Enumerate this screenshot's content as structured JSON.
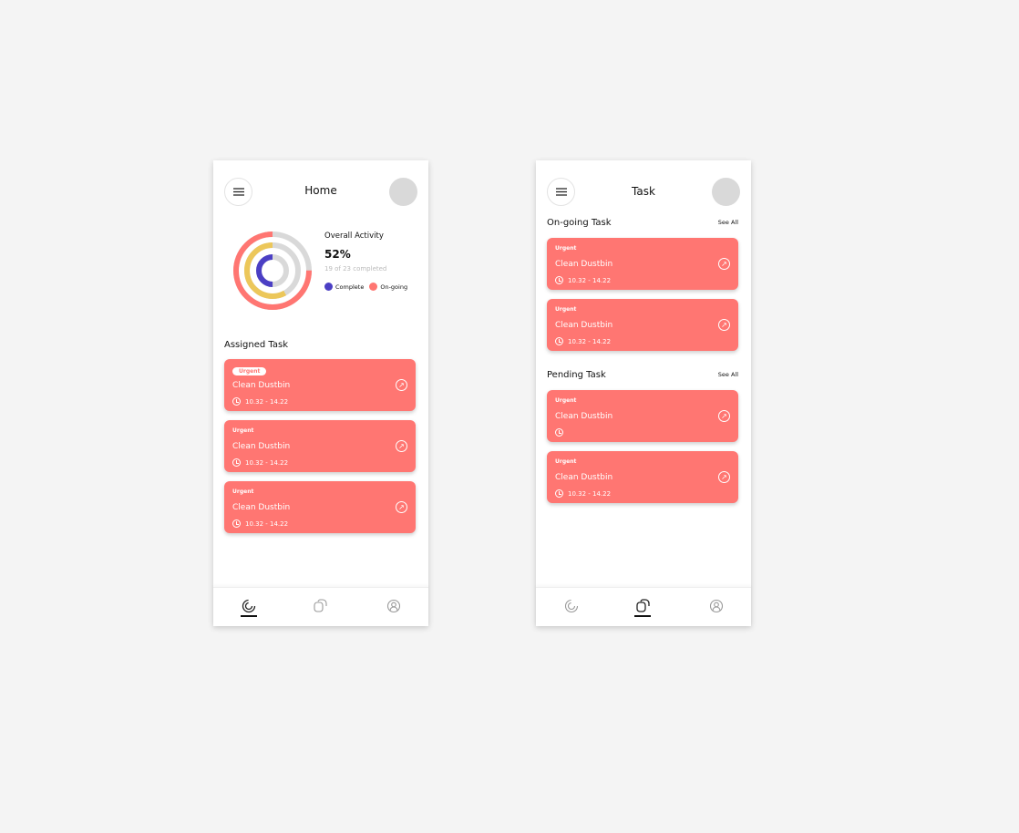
{
  "colors": {
    "card": "#ff7672",
    "complete": "#4b3fc4",
    "ongoing": "#ff7672",
    "yellow": "#ecc75a",
    "track": "#d9d9d9"
  },
  "home": {
    "title": "Home",
    "activity": {
      "title": "Overall Activity",
      "percent": "52%",
      "summary": "19 of 23 completed",
      "legend": [
        "Complete",
        "On-going"
      ],
      "rings": {
        "outer": 0.75,
        "middle": 0.58,
        "inner": 0.5
      }
    },
    "section": "Assigned Task",
    "tasks": [
      {
        "tag": "Urgent",
        "name": "Clean Dustbin",
        "time": "10.32 - 14.22"
      },
      {
        "tag": "Urgent",
        "name": "Clean Dustbin",
        "time": "10.32 - 14.22"
      },
      {
        "tag": "Urgent",
        "name": "Clean Dustbin",
        "time": "10.32 - 14.22"
      }
    ]
  },
  "task": {
    "title": "Task",
    "ongoing": {
      "title": "On-going Task",
      "see_all": "See All",
      "tasks": [
        {
          "tag": "Urgent",
          "name": "Clean Dustbin",
          "time": "10.32 - 14.22"
        },
        {
          "tag": "Urgent",
          "name": "Clean Dustbin",
          "time": "10.32 - 14.22"
        }
      ]
    },
    "pending": {
      "title": "Pending Task",
      "see_all": "See All",
      "tasks": [
        {
          "tag": "Urgent",
          "name": "Clean Dustbin",
          "time": ""
        },
        {
          "tag": "Urgent",
          "name": "Clean Dustbin",
          "time": "10.32 - 14.22"
        }
      ]
    }
  },
  "icons": {
    "menu": "hamburger-icon",
    "open": "arrow-up-right-circle-icon",
    "clock": "clock-icon",
    "nav": [
      "activity-icon",
      "tasks-icon",
      "profile-icon"
    ]
  }
}
